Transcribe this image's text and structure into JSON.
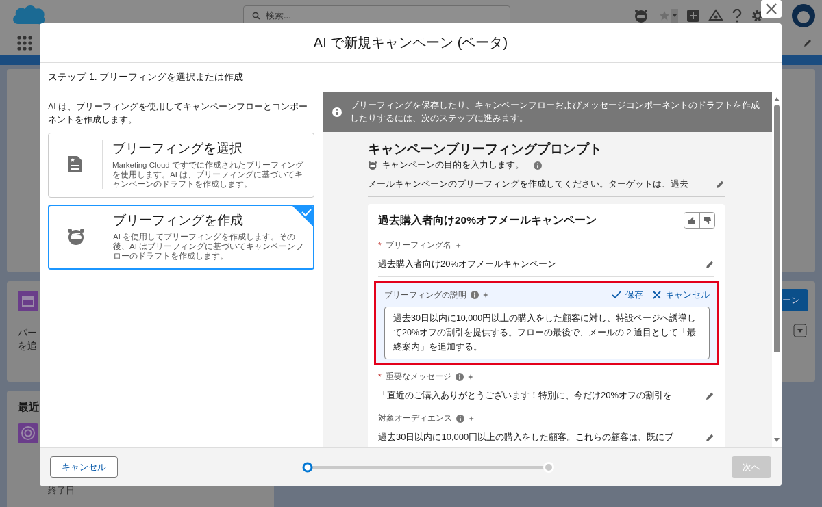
{
  "background": {
    "search_placeholder": "検索...",
    "card_texts": [
      "パー",
      "を追"
    ],
    "recent_title": "最近",
    "end_date_label": "終了日",
    "button_label": "ーン"
  },
  "modal": {
    "title": "AI で新規キャンペーン (ベータ)",
    "step_label": "ステップ 1. ブリーフィングを選択または作成",
    "intro": "AI は、ブリーフィングを使用してキャンペーンフローとコンポーネントを作成します。",
    "options": [
      {
        "kind": "select",
        "title": "ブリーフィングを選択",
        "description": "Marketing Cloud ですでに作成されたブリーフィングを使用します。AI は、ブリーフィングに基づいてキャンペーンのドラフトを作成します。",
        "selected": false
      },
      {
        "kind": "create",
        "title": "ブリーフィングを作成",
        "description": "AI を使用してブリーフィングを作成します。その後、AI はブリーフィングに基づいてキャンペーンフローのドラフトを作成します。",
        "selected": true
      }
    ],
    "banner": "ブリーフィングを保存したり、キャンペーンフローおよびメッセージコンポーネントのドラフトを作成したりするには、次のステップに進みます。",
    "prompt": {
      "heading": "キャンペーンブリーフィングプロンプト",
      "subtitle": "キャンペーンの目的を入力します。",
      "text": "メールキャンペーンのブリーフィングを作成してください。ターゲットは、過去"
    },
    "brief": {
      "title": "過去購入者向け20%オフメールキャンペーン",
      "fields": [
        {
          "kind": "text",
          "label": "ブリーフィング名",
          "required_mark": "*",
          "info": false,
          "value": "過去購入者向け20%オフメールキャンペーン"
        },
        {
          "kind": "editing",
          "label": "ブリーフィングの説明",
          "info": true,
          "value": "過去30日以内に10,000円以上の購入をした顧客に対し、特設ページへ誘導して20%オフの割引を提供する。フローの最後で、メールの 2 通目として「最終案内」を追加する。",
          "save": "保存",
          "cancel": "キャンセル"
        },
        {
          "kind": "text",
          "label": "重要なメッセージ",
          "required_mark": "*",
          "info": true,
          "value": "「直近のご購入ありがとうございます！特別に、今だけ20%オフの割引を"
        },
        {
          "kind": "text",
          "label": "対象オーディエンス",
          "info": true,
          "value": "過去30日以内に10,000円以上の購入をした顧客。これらの顧客は、既にブ"
        }
      ]
    },
    "footer": {
      "cancel": "キャンセル",
      "next": "次へ",
      "next_disabled": true,
      "progress": {
        "level": 0
      }
    }
  }
}
